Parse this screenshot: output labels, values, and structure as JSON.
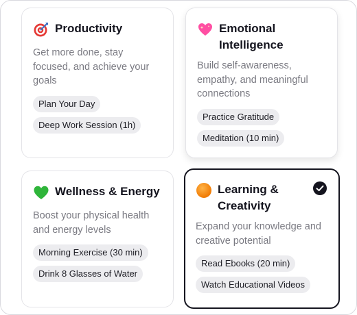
{
  "cards": [
    {
      "title": "Productivity",
      "icon": "target-icon",
      "description": "Get more done, stay focused, and achieve your goals",
      "activities": [
        "Plan Your Day",
        "Deep Work Session (1h)"
      ],
      "selected": false
    },
    {
      "title": "Emotional Intelligence",
      "icon": "sparkling-heart-icon",
      "description": "Build self-awareness, empathy, and meaningful connections",
      "activities": [
        "Practice Gratitude",
        "Meditation (10 min)"
      ],
      "selected": false
    },
    {
      "title": "Wellness & Energy",
      "icon": "green-heart-icon",
      "description": "Boost your physical health and energy levels",
      "activities": [
        "Morning Exercise (30 min)",
        "Drink 8 Glasses of Water"
      ],
      "selected": false
    },
    {
      "title": "Learning & Creativity",
      "icon": "orange-circle-icon",
      "description": "Expand your knowledge and creative potential",
      "activities": [
        "Read Ebooks (20 min)",
        "Watch Educational Videos"
      ],
      "selected": true
    }
  ],
  "colors": {
    "title": "#14141e",
    "description": "#7a7a82",
    "chip_bg": "#ececef",
    "selected_border": "#14141e"
  }
}
